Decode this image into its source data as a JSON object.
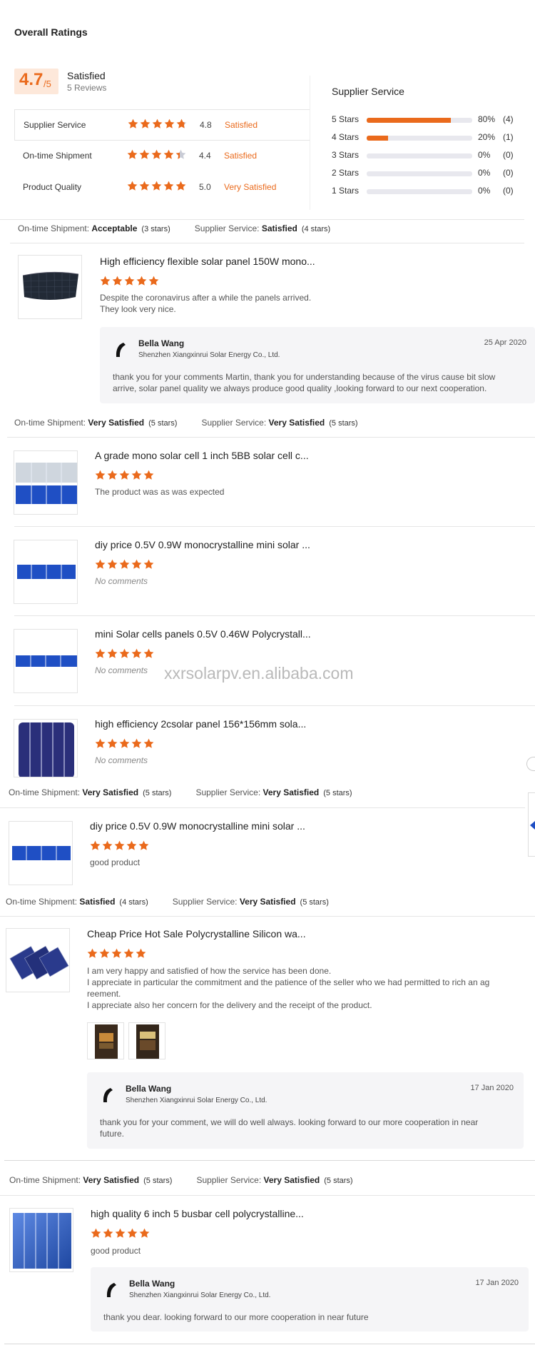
{
  "header": {
    "title": "Overall Ratings",
    "score": "4.7",
    "score_suffix": "/5",
    "satisfaction": "Satisfied",
    "reviews": "5 Reviews"
  },
  "ratings": [
    {
      "label": "Supplier Service",
      "score": "4.8",
      "stars_value": 4.8,
      "word": "Satisfied"
    },
    {
      "label": "On-time Shipment",
      "score": "4.4",
      "stars_value": 4.4,
      "word": "Satisfied"
    },
    {
      "label": "Product Quality",
      "score": "5.0",
      "stars_value": 5.0,
      "word": "Very Satisfied"
    }
  ],
  "supplier_service": {
    "title": "Supplier Service",
    "rows": [
      {
        "label": "5 Stars",
        "fraction": 0.8,
        "pct": "80%",
        "count": "(4)"
      },
      {
        "label": "4 Stars",
        "fraction": 0.2,
        "pct": "20%",
        "count": "(1)"
      },
      {
        "label": "3 Stars",
        "fraction": 0,
        "pct": "0%",
        "count": "(0)"
      },
      {
        "label": "2 Stars",
        "fraction": 0,
        "pct": "0%",
        "count": "(0)"
      },
      {
        "label": "1 Stars",
        "fraction": 0,
        "pct": "0%",
        "count": "(0)"
      }
    ]
  },
  "review_labels": {
    "ontime": "On-time Shipment:",
    "supplier": "Supplier Service:"
  },
  "reviews": [
    {
      "ontime_value": "Acceptable",
      "ontime_stars": "(3 stars)",
      "supplier_value": "Satisfied",
      "supplier_stars": "(4 stars)",
      "products": [
        {
          "title": "High efficiency flexible solar panel 150W mono...",
          "text": [
            "Despite the coronavirus after a while the panels arrived.",
            "They look very nice."
          ]
        }
      ],
      "reply": {
        "name": "Bella Wang",
        "company": "Shenzhen Xiangxinrui Solar Energy Co., Ltd.",
        "date": "25 Apr 2020",
        "text": [
          "thank you for your comments Martin, thank you for understanding because of the virus cause bit slow",
          "arrive, solar panel quality we always produce good quality ,looking forward to our next cooperation."
        ]
      }
    },
    {
      "ontime_value": "Very Satisfied",
      "ontime_stars": "(5 stars)",
      "supplier_value": "Very Satisfied",
      "supplier_stars": "(5 stars)",
      "products": [
        {
          "title": "A grade mono solar cell 1 inch 5BB solar cell c...",
          "text": [
            "The product was as was expected"
          ]
        },
        {
          "title": "diy price 0.5V 0.9W monocrystalline mini solar ...",
          "nocomment": "No comments"
        },
        {
          "title": "mini Solar cells panels 0.5V 0.46W Polycrystall...",
          "nocomment": "No comments"
        },
        {
          "title": "high efficiency 2csolar panel 156*156mm sola...",
          "nocomment": "No comments"
        }
      ]
    },
    {
      "ontime_value": "Very Satisfied",
      "ontime_stars": "(5 stars)",
      "supplier_value": "Very Satisfied",
      "supplier_stars": "(5 stars)",
      "products": [
        {
          "title": "diy price 0.5V 0.9W monocrystalline mini solar ...",
          "text": [
            "good product"
          ]
        }
      ]
    },
    {
      "ontime_value": "Satisfied",
      "ontime_stars": "(4 stars)",
      "supplier_value": "Very Satisfied",
      "supplier_stars": "(5 stars)",
      "products": [
        {
          "title": "Cheap Price Hot Sale Polycrystalline Silicon wa...",
          "text": [
            "I am very happy and satisfied of how the service has been done.",
            "I appreciate in particular the commitment and the patience of the seller who we had permitted to rich an ag",
            "reement.",
            "I appreciate also her  concern for the delivery and the receipt of the product."
          ]
        }
      ],
      "reply": {
        "name": "Bella Wang",
        "company": "Shenzhen Xiangxinrui Solar Energy Co., Ltd.",
        "date": "17 Jan 2020",
        "text": [
          "thank you for your comment,  we will do well always. looking forward to  our more cooperation in near",
          "future."
        ]
      }
    },
    {
      "ontime_value": "Very Satisfied",
      "ontime_stars": "(5 stars)",
      "supplier_value": "Very Satisfied",
      "supplier_stars": "(5 stars)",
      "products": [
        {
          "title": "high quality 6 inch 5 busbar cell polycrystalline...",
          "text": [
            "good product"
          ]
        }
      ],
      "reply": {
        "name": "Bella Wang",
        "company": "Shenzhen Xiangxinrui Solar Energy Co., Ltd.",
        "date": "17 Jan 2020",
        "text": [
          "thank you dear. looking forward to  our more cooperation in near future"
        ]
      }
    }
  ],
  "watermark": "xxrsolarpv.en.alibaba.com",
  "colors": {
    "accent": "#ea6a1c",
    "star_empty": "#c9ccd6",
    "panel_blue": "#1f4fc4",
    "reply_bg": "#f5f5f7"
  },
  "icons": {
    "star": "star-icon",
    "logo": "company-logo-icon"
  }
}
